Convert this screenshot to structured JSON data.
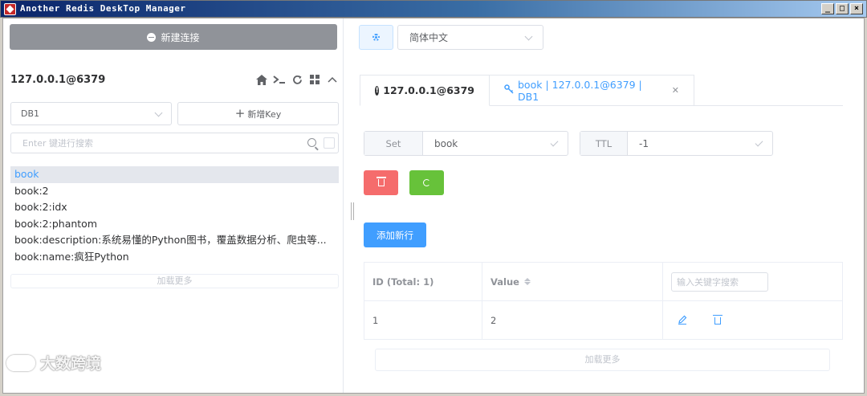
{
  "window": {
    "title": "Another Redis DeskTop Manager",
    "controls": [
      "_",
      "□",
      "×"
    ]
  },
  "sidebar": {
    "new_connection_label": "新建连接",
    "connection_name": "127.0.0.1@6379",
    "db_select_value": "DB1",
    "add_key_label": "新增Key",
    "search_placeholder": "Enter 键进行搜索",
    "keys": [
      "book",
      "book:2",
      "book:2:idx",
      "book:2:phantom",
      "book:description:系统易懂的Python图书，覆盖数据分析、爬虫等...",
      "book:name:疯狂Python"
    ],
    "selected_key_index": 0,
    "load_more_label": "加载更多"
  },
  "toolbar": {
    "language_value": "简体中文"
  },
  "tabs": [
    {
      "label": "127.0.0.1@6379",
      "icon": "info-icon"
    },
    {
      "label": "book | 127.0.0.1@6379 | DB1",
      "icon": "key-icon",
      "closable": true
    }
  ],
  "key_detail": {
    "type_label": "Set",
    "key_value": "book",
    "ttl_label": "TTL",
    "ttl_value": "-1",
    "add_row_label": "添加新行",
    "table": {
      "headers": [
        "ID (Total: 1)",
        "Value"
      ],
      "filter_placeholder": "输入关键字搜索",
      "rows": [
        {
          "id": "1",
          "value": "2"
        }
      ]
    },
    "load_more_label": "加载更多"
  },
  "watermark": {
    "text": "大数跨境"
  },
  "colors": {
    "primary": "#409eff",
    "danger": "#f56c6c",
    "success": "#67c23a",
    "info": "#909399"
  }
}
